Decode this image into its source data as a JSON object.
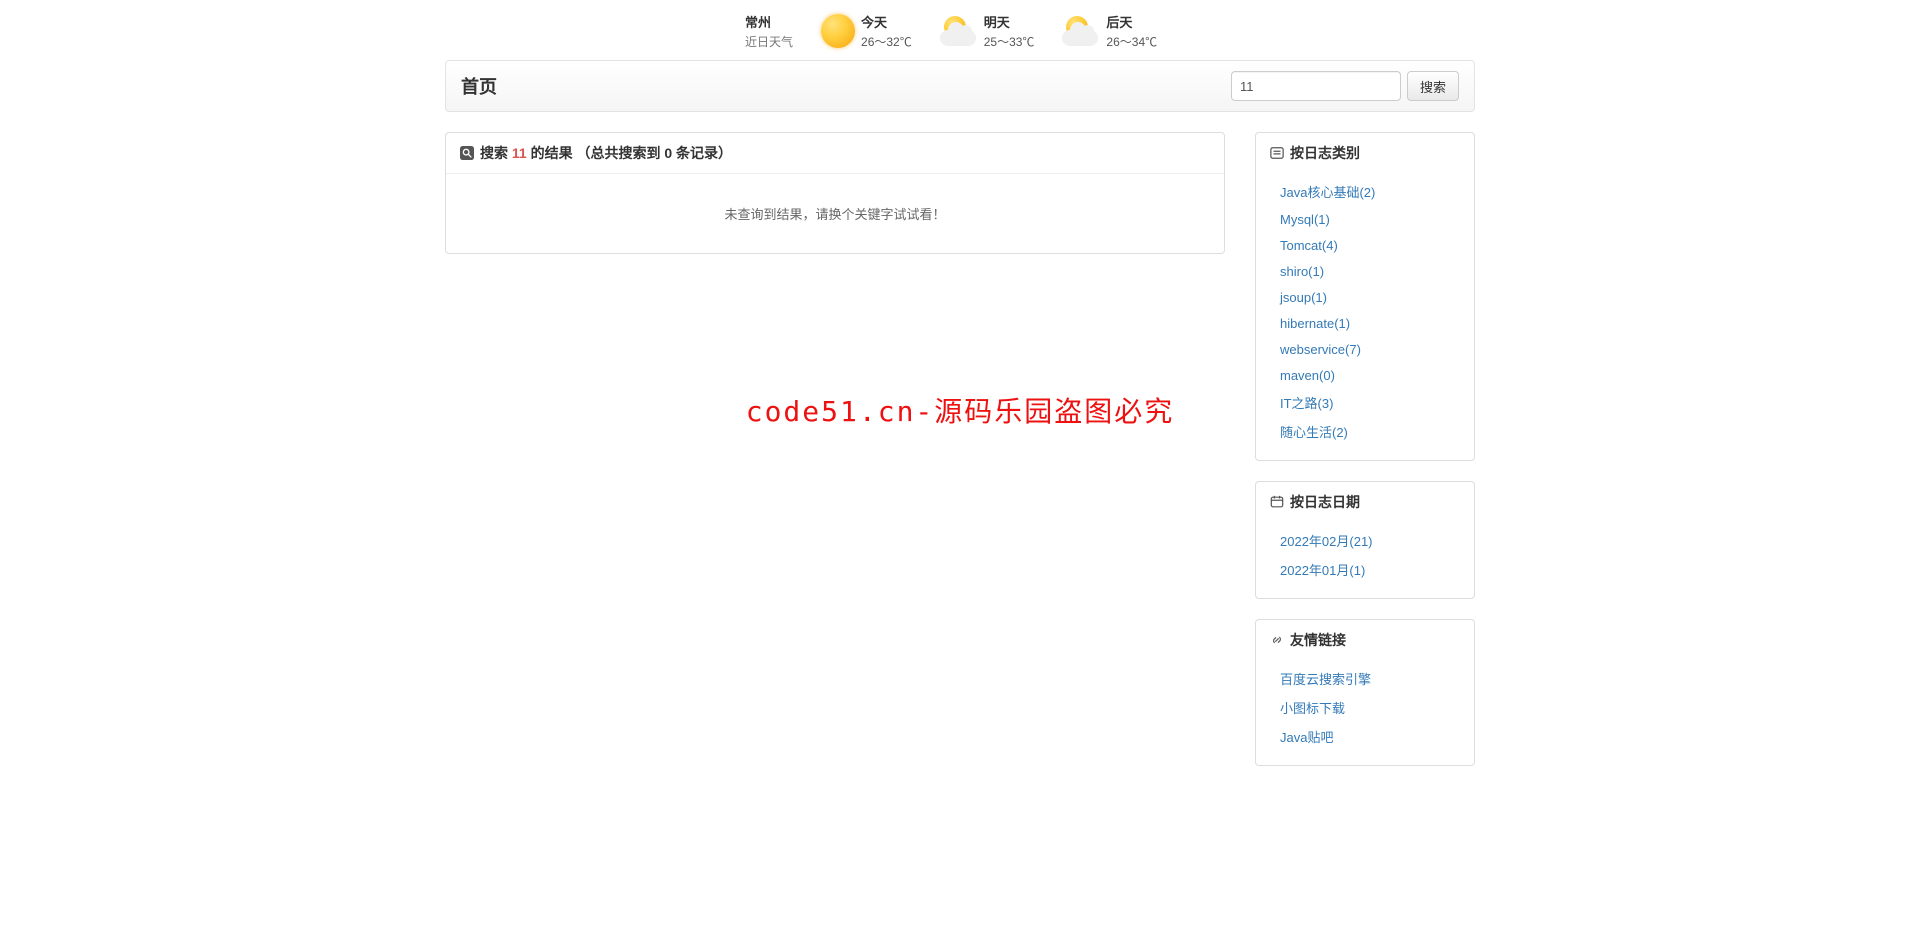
{
  "weather": {
    "city": "常州",
    "subtitle": "近日天气",
    "days": [
      {
        "label": "今天",
        "temp": "26～32℃",
        "icon": "sun"
      },
      {
        "label": "明天",
        "temp": "25～33℃",
        "icon": "sun-cloud"
      },
      {
        "label": "后天",
        "temp": "26～34℃",
        "icon": "sun-cloud"
      }
    ]
  },
  "header": {
    "title": "首页",
    "search_value": "11",
    "search_button": "搜索"
  },
  "results": {
    "prefix": "搜索 ",
    "term": "11",
    "suffix": " 的结果",
    "count_text": "（总共搜索到 0 条记录）",
    "empty_message": "未查询到结果，请换个关键字试试看！"
  },
  "sidebar": {
    "categories": {
      "title": "按日志类别",
      "items": [
        "Java核心基础(2)",
        "Mysql(1)",
        "Tomcat(4)",
        "shiro(1)",
        "jsoup(1)",
        "hibernate(1)",
        "webservice(7)",
        "maven(0)",
        "IT之路(3)",
        "随心生活(2)"
      ]
    },
    "dates": {
      "title": "按日志日期",
      "items": [
        "2022年02月(21)",
        "2022年01月(1)"
      ]
    },
    "links": {
      "title": "友情链接",
      "items": [
        "百度云搜索引擎",
        "小图标下载",
        "Java贴吧"
      ]
    }
  },
  "watermark": "code51.cn-源码乐园盗图必究"
}
